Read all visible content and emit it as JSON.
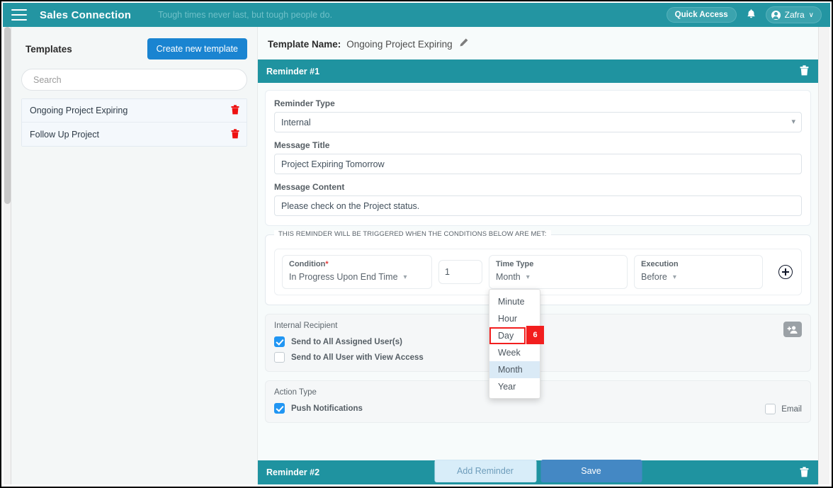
{
  "topbar": {
    "brand": "Sales Connection",
    "tagline": "Tough times never last, but tough people do.",
    "quick_access": "Quick Access",
    "user_name": "Zafra",
    "caret": "∨",
    "bell_icon": "🔔"
  },
  "sidebar": {
    "title": "Templates",
    "create_button": "Create new template",
    "search_placeholder": "Search",
    "search_value": "",
    "items": [
      {
        "label": "Ongoing Project Expiring",
        "delete_icon": "🗑"
      },
      {
        "label": "Follow Up Project",
        "delete_icon": "🗑"
      }
    ]
  },
  "main": {
    "template_name_label": "Template Name:",
    "template_name_value": "Ongoing Project Expiring",
    "edit_icon": "✎",
    "reminder1_title": "Reminder #1",
    "reminder2_title": "Reminder #2",
    "delete_icon": "🗑",
    "fields": {
      "reminder_type_label": "Reminder Type",
      "reminder_type_value": "Internal",
      "message_title_label": "Message Title",
      "message_title_value": "Project Expiring Tomorrow",
      "message_content_label": "Message Content",
      "message_content_value": "Please check on the Project status."
    },
    "conditions": {
      "legend": "THIS REMINDER WILL BE TRIGGERED WHEN THE CONDITIONS BELOW ARE MET:",
      "condition_label": "Condition",
      "condition_required": "*",
      "condition_value": "In Progress Upon End Time",
      "amount_value": "1",
      "time_type_label": "Time Type",
      "time_type_value": "Month",
      "execution_label": "Execution",
      "execution_value": "Before",
      "add_icon": "+",
      "dropdown_options": [
        {
          "label": "Minute",
          "state": "normal"
        },
        {
          "label": "Hour",
          "state": "normal"
        },
        {
          "label": "Day",
          "state": "highlighted",
          "badge": "6"
        },
        {
          "label": "Week",
          "state": "normal"
        },
        {
          "label": "Month",
          "state": "selected"
        },
        {
          "label": "Year",
          "state": "normal"
        }
      ]
    },
    "recipient": {
      "title": "Internal Recipient",
      "add_user_icon": "add-user-icon",
      "checkboxes": [
        {
          "label": "Send to All Assigned User(s)",
          "checked": true
        },
        {
          "label": "Send to All User with View Access",
          "checked": false
        }
      ]
    },
    "action_type": {
      "title": "Action Type",
      "push_label": "Push Notifications",
      "push_checked": true,
      "email_label": "Email",
      "email_checked": false
    },
    "buttons": {
      "add_reminder": "Add Reminder",
      "save": "Save"
    }
  },
  "colors": {
    "teal_header": "#2395a2",
    "reminder_header": "#1f93a0",
    "create_blue": "#1a84d1",
    "save_blue": "#4488c4",
    "highlight_red": "#f21e1e",
    "checkbox_blue": "#2196f3",
    "trash_red": "#ee1111"
  }
}
